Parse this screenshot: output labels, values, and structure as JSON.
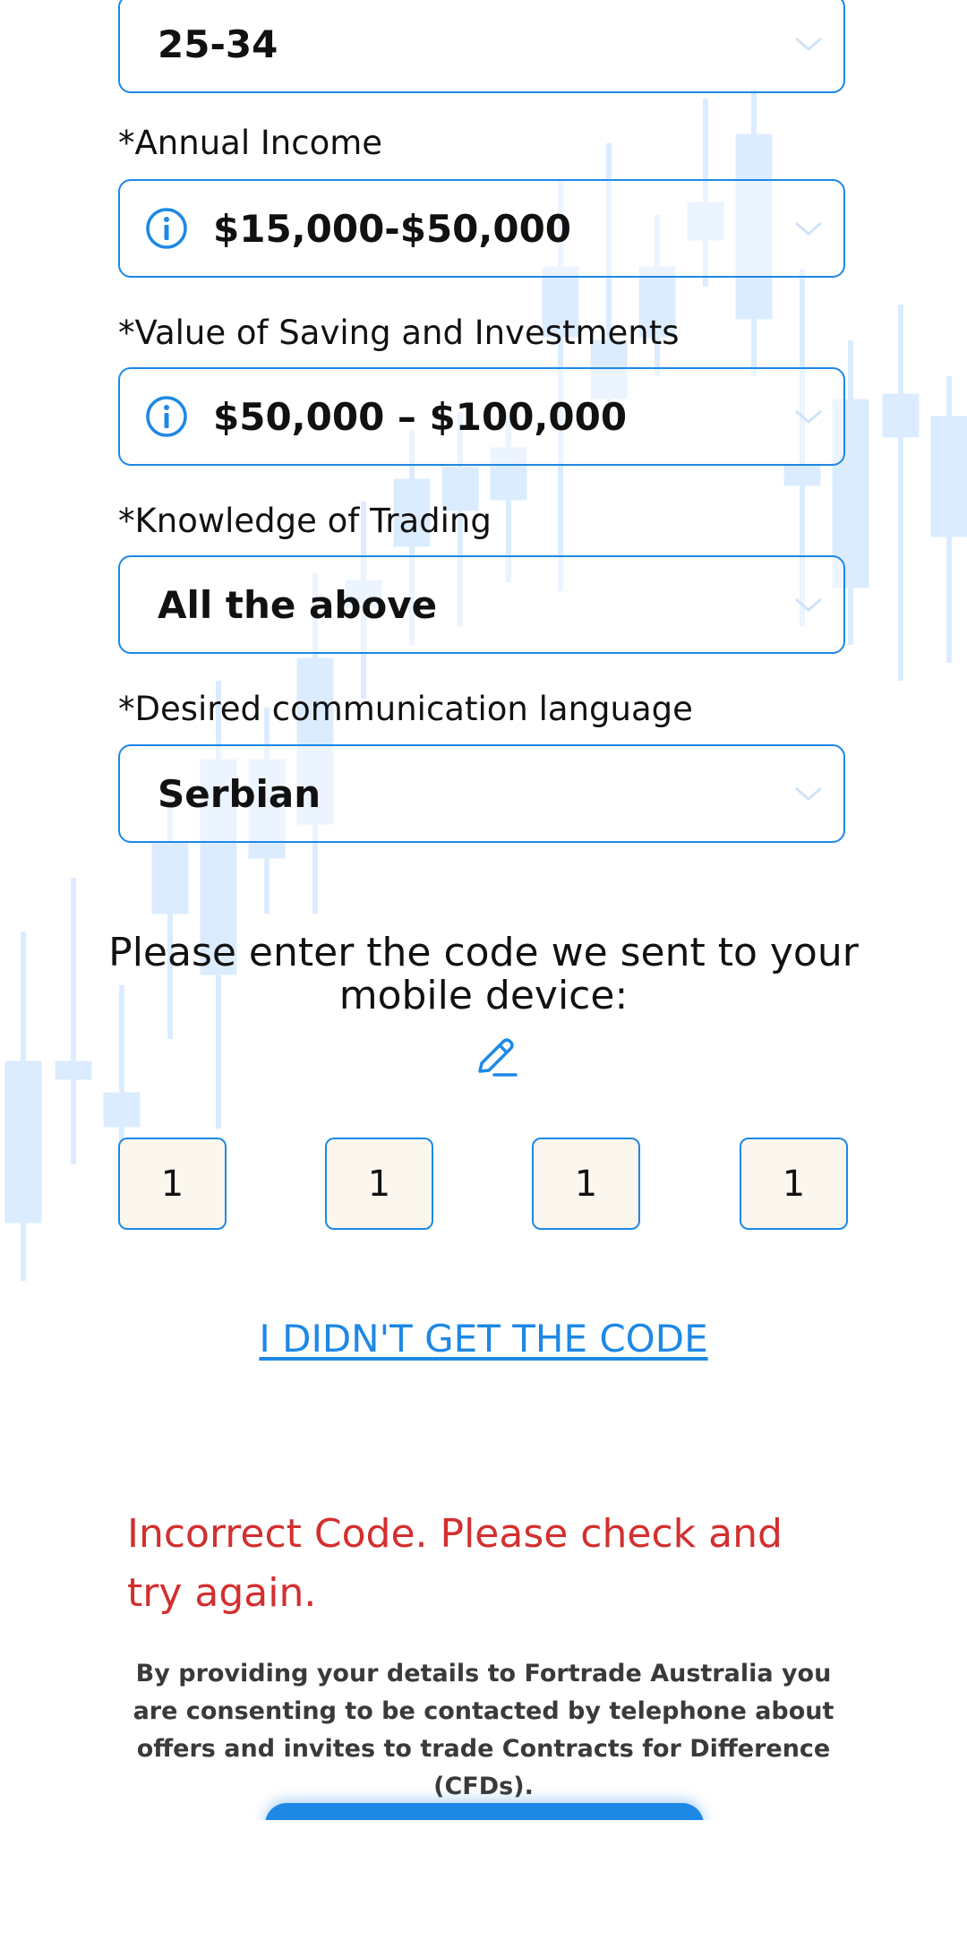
{
  "form": {
    "age": {
      "value": "25-34"
    },
    "annual_income": {
      "label": "*Annual Income",
      "value": "$15,000-$50,000"
    },
    "savings": {
      "label": "*Value of Saving and Investments",
      "value": "$50,000 – $100,000"
    },
    "knowledge": {
      "label": "*Knowledge of Trading",
      "value": "All the above"
    },
    "language": {
      "label": "*Desired communication language",
      "value": "Serbian"
    }
  },
  "verification": {
    "prompt": "Please enter the code we sent to your mobile device:",
    "digits": [
      "1",
      "1",
      "1",
      "1"
    ],
    "resend_link": "I DIDN'T GET THE CODE",
    "error_message": "Incorrect Code. Please check and try again."
  },
  "disclaimer": "By providing your details to Fortrade Australia you are consenting to be contacted by telephone about offers and invites to trade Contracts for Difference (CFDs).",
  "colors": {
    "accent": "#1e88e5",
    "error": "#d32f2f",
    "code_box_bg": "#fcf7ee",
    "background_candles": "#dcecff"
  },
  "icons": {
    "info": "info-circle-icon",
    "dropdown": "chevron-down-icon",
    "edit": "pencil-edit-icon"
  }
}
